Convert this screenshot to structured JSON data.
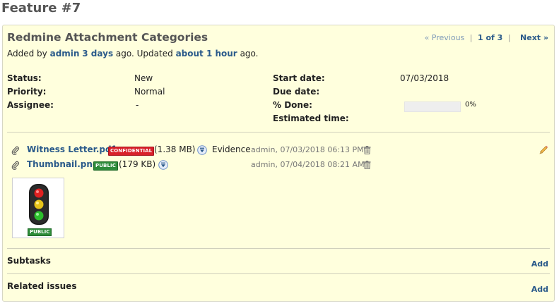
{
  "page": {
    "title": "Feature #7"
  },
  "issue": {
    "subject": "Redmine Attachment Categories",
    "nav": {
      "previous": "« Previous",
      "position": "1 of 3",
      "separator": "|",
      "next": "Next »"
    },
    "author_line": {
      "added_by": "Added by",
      "author": "admin",
      "created_ago": "3 days",
      "ago_updated": "ago. Updated",
      "updated_ago": "about 1 hour",
      "ago_end": "ago."
    },
    "attributes": {
      "status": {
        "label": "Status:",
        "value": "New"
      },
      "priority": {
        "label": "Priority:",
        "value": "Normal"
      },
      "assignee": {
        "label": "Assignee:",
        "value": "-"
      },
      "start_date": {
        "label": "Start date:",
        "value": "07/03/2018"
      },
      "due_date": {
        "label": "Due date:",
        "value": ""
      },
      "done": {
        "label": "% Done:",
        "value": "0%",
        "fraction": 0
      },
      "estimated_time": {
        "label": "Estimated time:",
        "value": ""
      }
    }
  },
  "attachments": [
    {
      "filename": "Witness Letter.pdf",
      "badge": "CONFIDENTIAL",
      "badge_color": "#d8202a",
      "size": "(1.38 MB)",
      "description": "Evidence",
      "meta": "admin, 07/03/2018 06:13 PM"
    },
    {
      "filename": "Thumbnail.png",
      "badge": "PUBLIC",
      "badge_color": "#2e8b3a",
      "size": "(179 KB)",
      "description": "",
      "meta": "admin, 07/04/2018 08:21 AM"
    }
  ],
  "thumbnail": {
    "badge": "PUBLIC",
    "icon": "traffic-light-icon"
  },
  "sections": {
    "subtasks": {
      "title": "Subtasks",
      "add": "Add"
    },
    "related": {
      "title": "Related issues",
      "add": "Add"
    }
  },
  "icons": {
    "attachment": "paperclip-icon",
    "download": "download-icon",
    "delete": "trash-icon",
    "edit": "pencil-icon"
  }
}
